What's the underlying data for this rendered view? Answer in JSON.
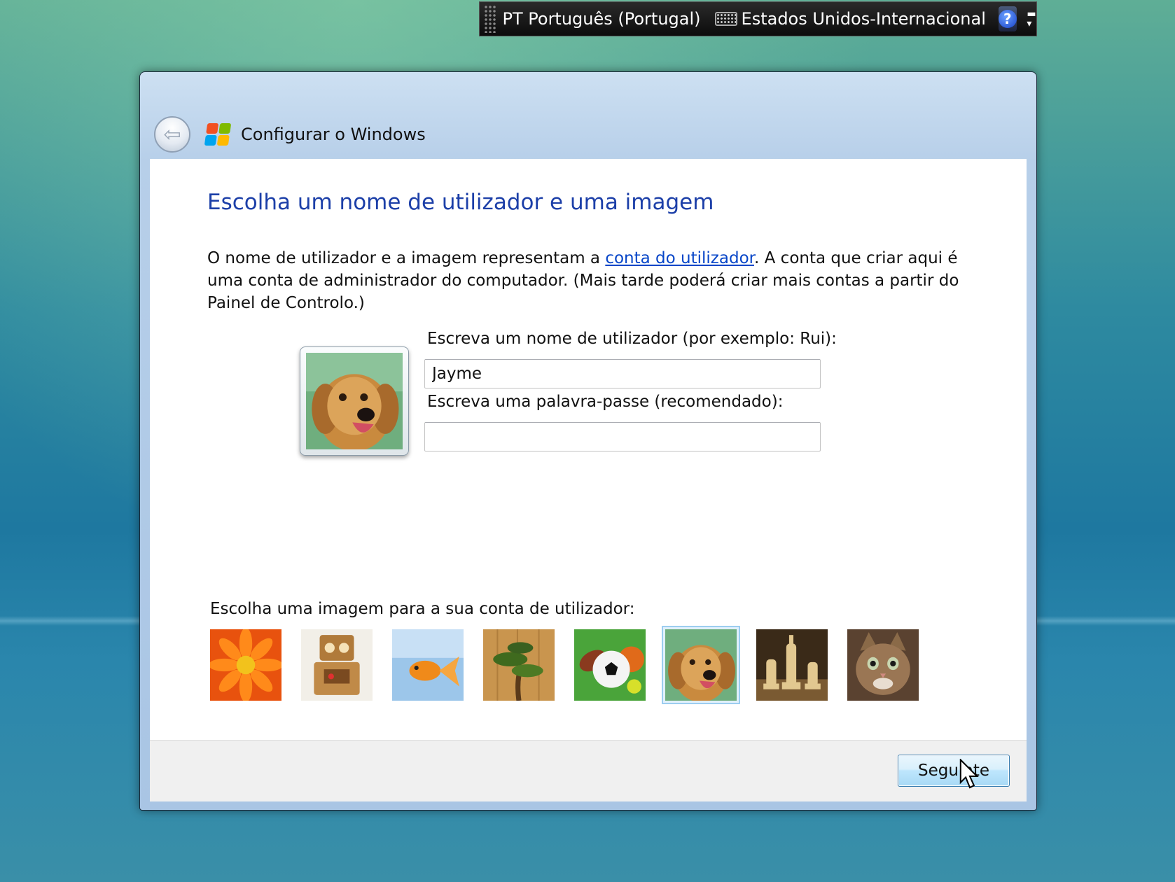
{
  "language_bar": {
    "language": "PT Português (Portugal)",
    "keyboard": "Estados Unidos-Internacional",
    "help_glyph": "?",
    "icons": [
      "grip-icon",
      "keyboard-icon",
      "help-icon",
      "options-icon"
    ]
  },
  "window": {
    "title": "Configurar o Windows",
    "back_glyph": "⇦",
    "heading": "Escolha um nome de utilizador e uma imagem",
    "description": {
      "before_link": "O nome de utilizador e a imagem representam a ",
      "link": "conta do utilizador",
      "after_link": ". A conta que criar aqui é uma conta de administrador do computador. (Mais tarde poderá criar mais contas a partir do Painel de Controlo.)"
    },
    "username": {
      "label": "Escreva um nome de utilizador (por exemplo: Rui):",
      "value": "Jayme"
    },
    "password": {
      "label": "Escreva uma palavra-passe (recomendado):",
      "value": ""
    },
    "picture_picker": {
      "label": "Escolha uma imagem para a sua conta de utilizador:",
      "pictures": [
        "flower",
        "robot",
        "goldfish",
        "bonsai",
        "sports-balls",
        "puppy",
        "chess",
        "kitten"
      ],
      "selected": "puppy"
    },
    "next_button": "Seguinte"
  },
  "colors": {
    "heading": "#1c3fa8",
    "link": "#0645c8",
    "windows_logo": [
      "#f25022",
      "#7fba00",
      "#00a4ef",
      "#ffb900"
    ]
  }
}
